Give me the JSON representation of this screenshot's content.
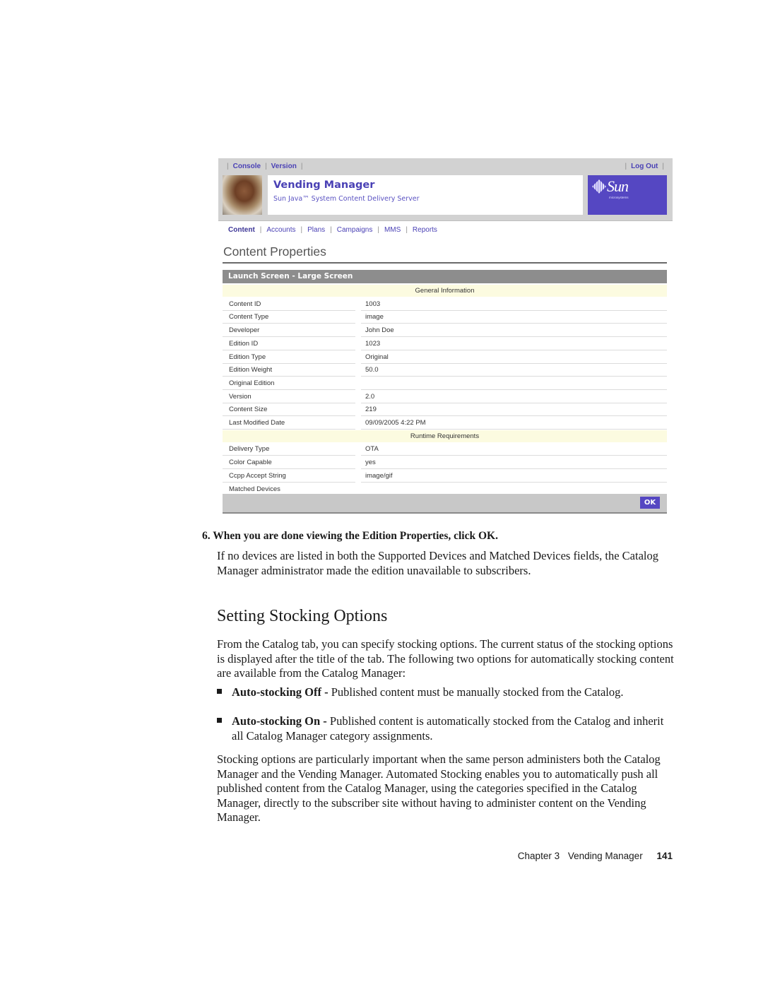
{
  "screenshot": {
    "utility_nav": {
      "left_links": [
        "Console",
        "Version"
      ],
      "right_links": [
        "Log Out"
      ]
    },
    "banner": {
      "title": "Vending Manager",
      "subtitle": "Sun Java™ System Content Delivery Server",
      "logo_text": "Sun",
      "logo_subtext": "microsystems"
    },
    "tabs": [
      {
        "label": "Content",
        "active": true
      },
      {
        "label": "Accounts",
        "active": false
      },
      {
        "label": "Plans",
        "active": false
      },
      {
        "label": "Campaigns",
        "active": false
      },
      {
        "label": "MMS",
        "active": false
      },
      {
        "label": "Reports",
        "active": false
      }
    ],
    "page_title": "Content Properties",
    "table_title": "Launch Screen - Large Screen",
    "sections": [
      {
        "heading": "General Information",
        "rows": [
          {
            "label": "Content ID",
            "value": "1003"
          },
          {
            "label": "Content Type",
            "value": "image"
          },
          {
            "label": "Developer",
            "value": "John Doe"
          },
          {
            "label": "Edition ID",
            "value": "1023"
          },
          {
            "label": "Edition Type",
            "value": "Original"
          },
          {
            "label": "Edition Weight",
            "value": "50.0"
          },
          {
            "label": "Original Edition",
            "value": ""
          },
          {
            "label": "Version",
            "value": "2.0"
          },
          {
            "label": "Content Size",
            "value": "219"
          },
          {
            "label": "Last Modified Date",
            "value": "09/09/2005 4:22 PM"
          }
        ]
      },
      {
        "heading": "Runtime Requirements",
        "rows": [
          {
            "label": "Delivery Type",
            "value": "OTA"
          },
          {
            "label": "Color Capable",
            "value": "yes"
          },
          {
            "label": "Ccpp Accept String",
            "value": "image/gif"
          },
          {
            "label": "Matched Devices",
            "value": ""
          }
        ]
      }
    ],
    "ok_button": "OK",
    "colors": {
      "brand": "#5547c2",
      "link": "#4a41b5",
      "section_bg": "#fcfbe0",
      "header_bar": "#8d8d8d"
    }
  },
  "document": {
    "step_number": "6.",
    "step_text": "When you are done viewing the Edition Properties, click OK.",
    "step_para": "If no devices are listed in both the Supported Devices and Matched Devices fields, the Catalog Manager administrator made the edition unavailable to subscribers.",
    "heading": "Setting Stocking Options",
    "intro_para": "From the Catalog tab, you can specify stocking options. The current status of the stocking options is displayed after the title of the tab. The following two options for automatically stocking content are available from the Catalog Manager:",
    "bullets": [
      {
        "term": "Auto-stocking Off -",
        "text": " Published content must be manually stocked from the Catalog."
      },
      {
        "term": "Auto-stocking On -",
        "text": " Published content is automatically stocked from the Catalog and inherit all Catalog Manager category assignments."
      }
    ],
    "closing_para": "Stocking options are particularly important when the same person administers both the Catalog Manager and the Vending Manager. Automated Stocking enables you to automatically push all published content from the Catalog Manager, using the categories specified in the Catalog Manager, directly to the subscriber site without having to administer content on the Vending Manager.",
    "footer": {
      "chapter": "Chapter 3",
      "chapter_title": "Vending Manager",
      "page_number": "141"
    }
  }
}
